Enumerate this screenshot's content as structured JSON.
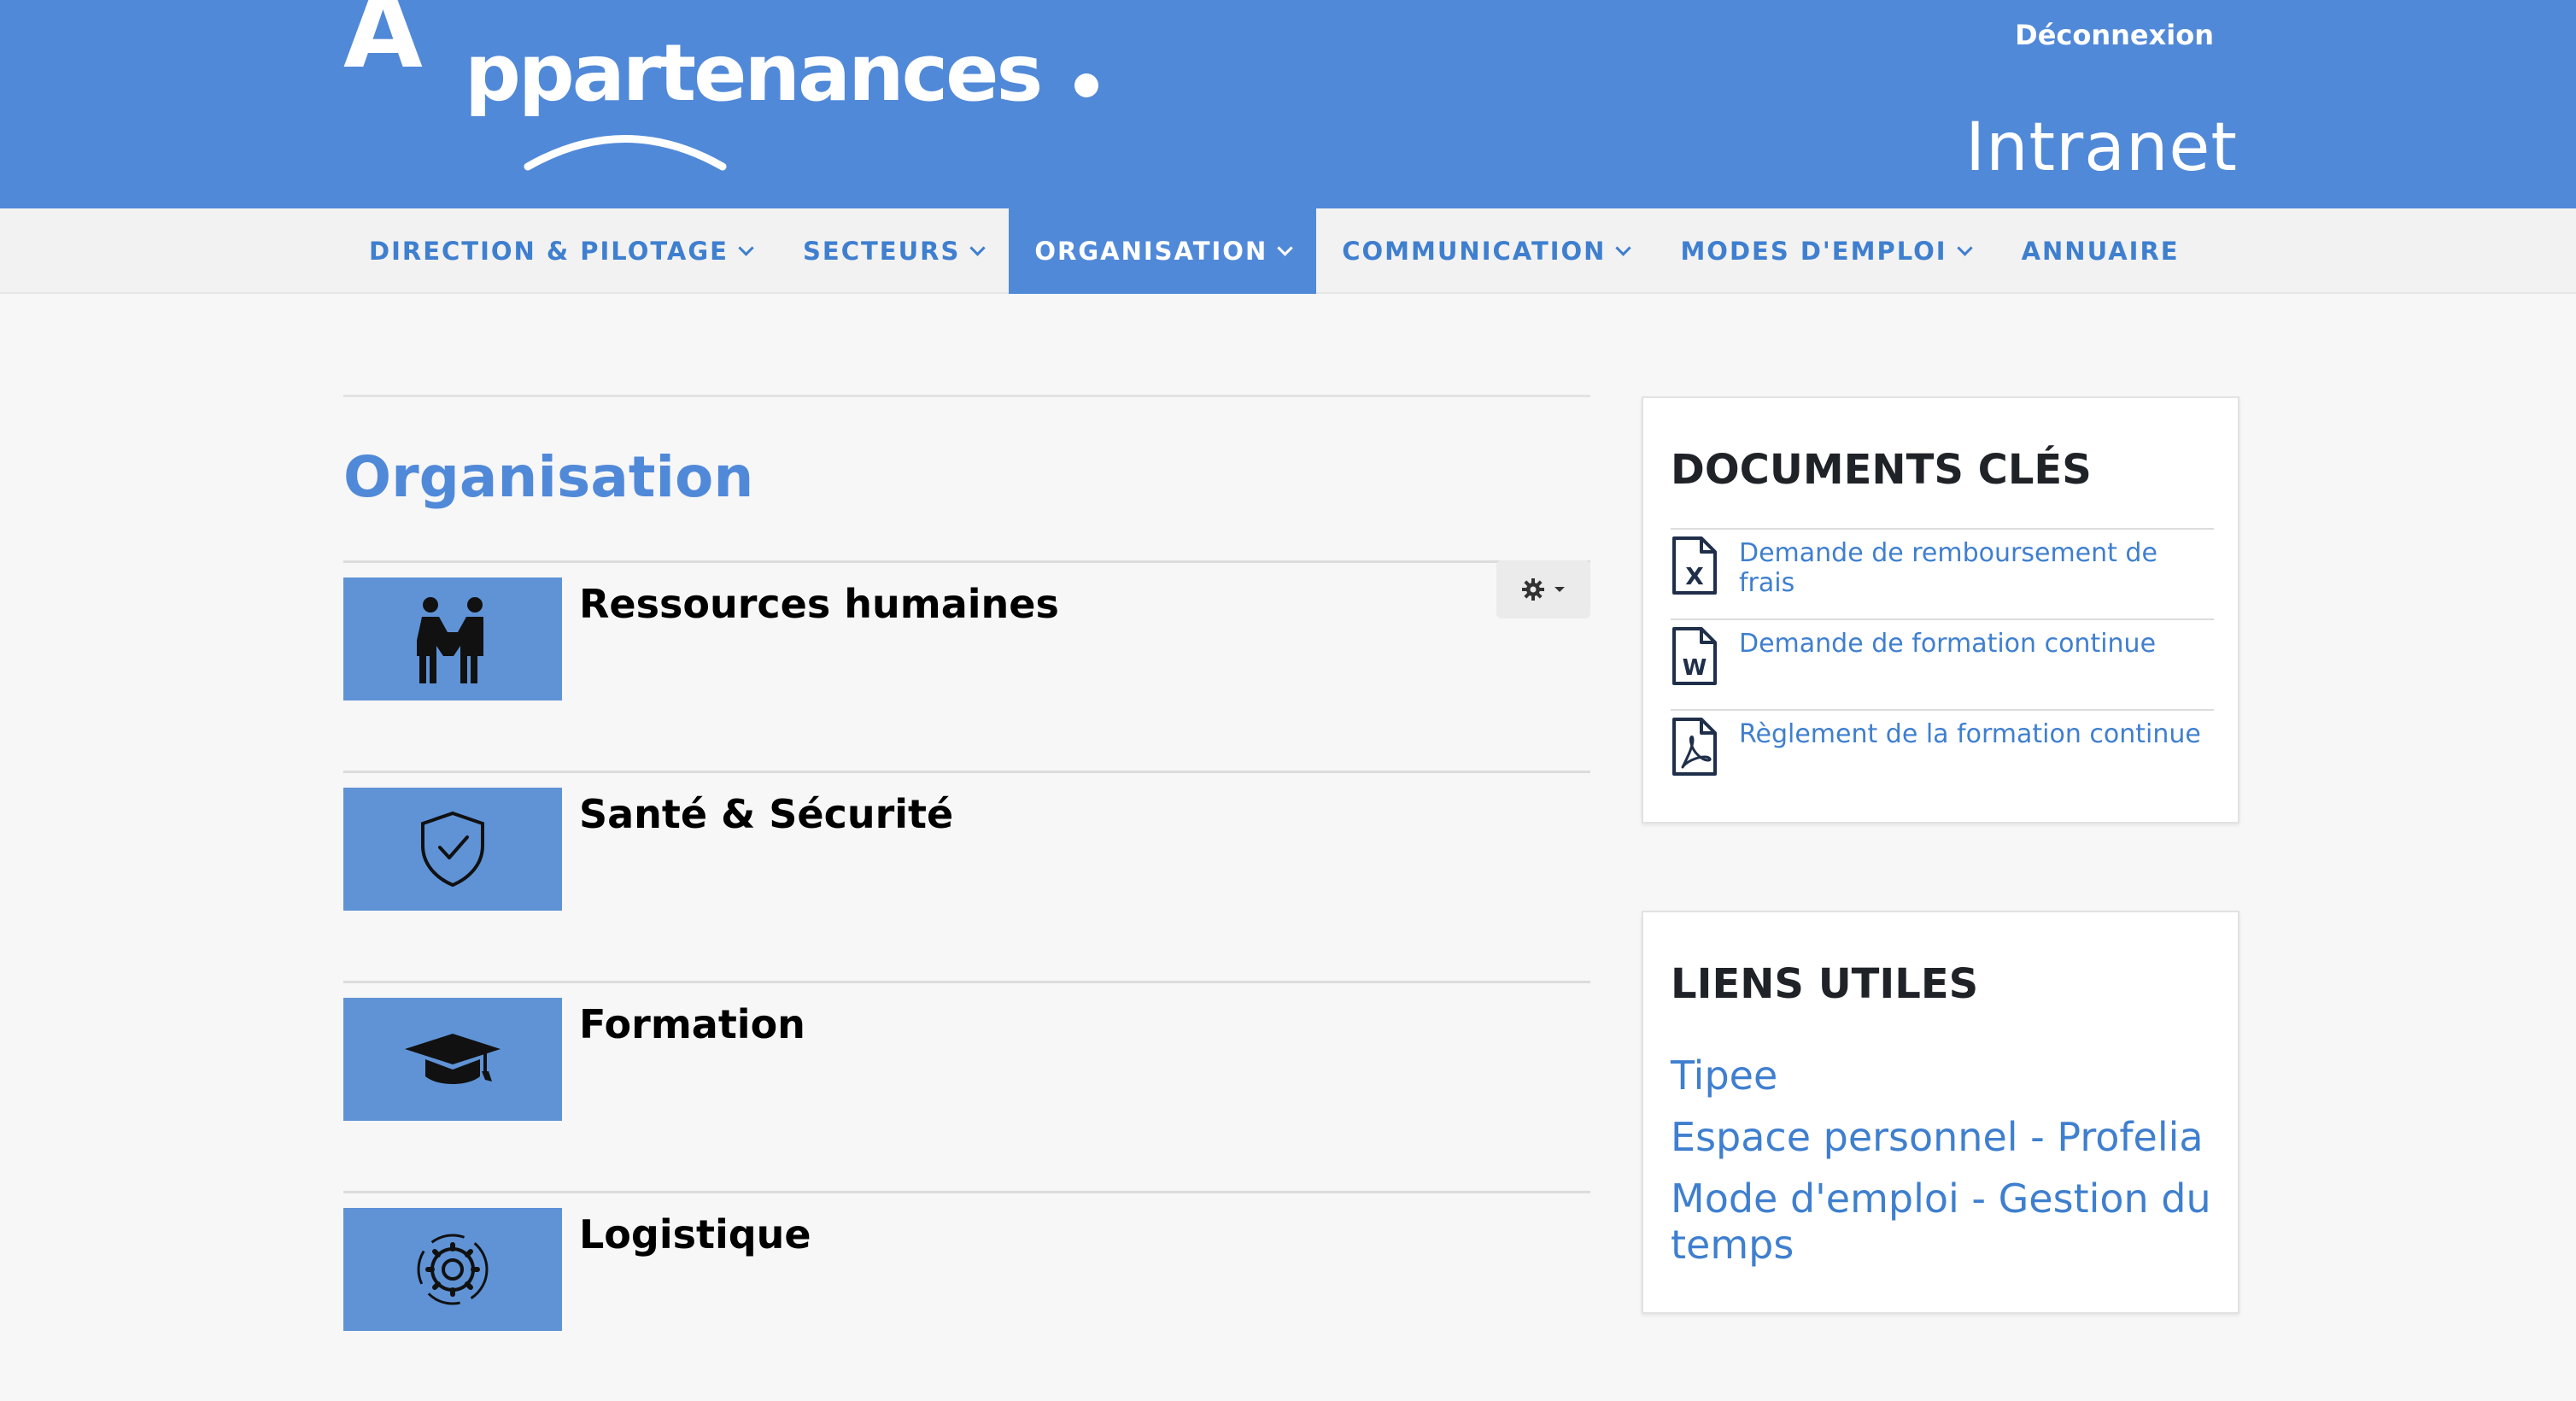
{
  "header": {
    "logo_letter": "A",
    "logo_word": "ppartenances",
    "logout": "Déconnexion",
    "intranet": "Intranet",
    "brand_color": "#5189d9"
  },
  "nav": {
    "items": [
      {
        "label": "DIRECTION & PILOTAGE",
        "dropdown": true,
        "active": false
      },
      {
        "label": "SECTEURS",
        "dropdown": true,
        "active": false
      },
      {
        "label": "ORGANISATION",
        "dropdown": true,
        "active": true
      },
      {
        "label": "COMMUNICATION",
        "dropdown": true,
        "active": false
      },
      {
        "label": "MODES D'EMPLOI",
        "dropdown": true,
        "active": false
      },
      {
        "label": "ANNUAIRE",
        "dropdown": false,
        "active": false
      }
    ],
    "search_icon": "search-icon"
  },
  "main": {
    "title": "Organisation",
    "sections": [
      {
        "label": "Ressources humaines",
        "icon": "handshake-icon"
      },
      {
        "label": "Santé & Sécurité",
        "icon": "shield-check-icon"
      },
      {
        "label": "Formation",
        "icon": "graduation-cap-icon"
      },
      {
        "label": "Logistique",
        "icon": "gear-cycle-icon"
      }
    ],
    "settings_icon": "gear-icon"
  },
  "sidebar": {
    "documents": {
      "title": "DOCUMENTS CLÉS",
      "items": [
        {
          "label": "Demande de remboursement de frais",
          "icon": "excel-file-icon"
        },
        {
          "label": "Demande de formation continue",
          "icon": "word-file-icon"
        },
        {
          "label": "Règlement de la formation continue",
          "icon": "pdf-file-icon"
        }
      ]
    },
    "links": {
      "title": "LIENS UTILES",
      "items": [
        {
          "label": "Tipee"
        },
        {
          "label": "Espace personnel - Profelia"
        },
        {
          "label": "Mode d'emploi - Gestion du temps"
        }
      ]
    }
  }
}
